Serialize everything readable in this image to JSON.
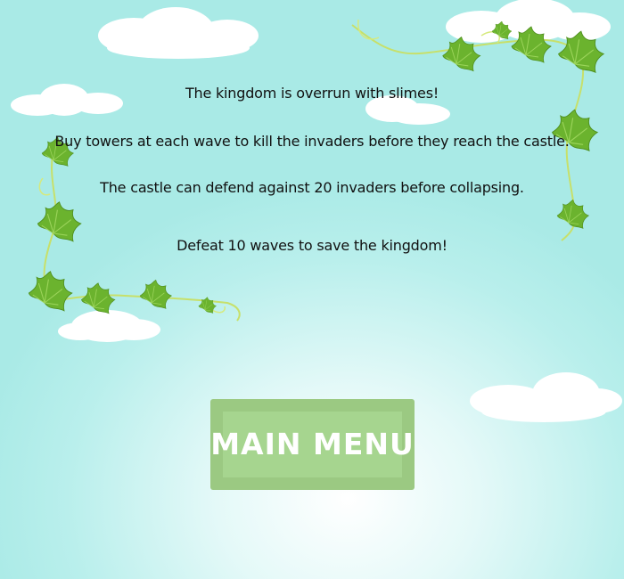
{
  "intro": {
    "lines": [
      "The kingdom is overrun with slimes!",
      "Buy towers at each wave to kill the invaders before they reach the castle.",
      "The castle can defend against 20 invaders before collapsing.",
      "Defeat 10 waves to save the kingdom!"
    ]
  },
  "buttons": {
    "main_menu_label": "MAIN MENU"
  },
  "colors": {
    "sky": "#b3ecea",
    "cloud": "#ffffff",
    "leaf": "#6bb32e",
    "vine": "#c7e06a",
    "button_outer": "#9bc982",
    "button_inner": "#a6d58f",
    "button_text": "#ffffff",
    "text": "#111111"
  },
  "decor": {
    "clouds": "cloud-shapes",
    "vines": "ivy-vine-frame"
  }
}
